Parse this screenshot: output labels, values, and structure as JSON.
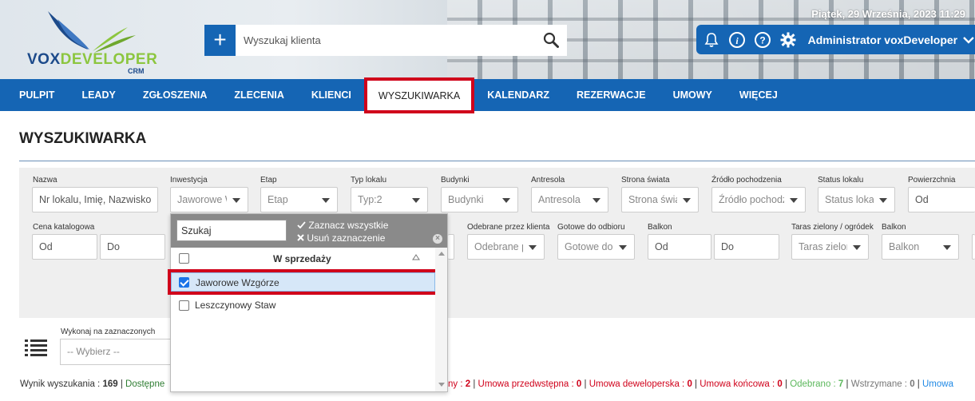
{
  "header": {
    "logo_brand_a": "VOX",
    "logo_brand_b": "DEVELOPER",
    "logo_sub": "CRM",
    "search_placeholder": "Wyszukaj klienta",
    "add_label": "+",
    "date_time": "Piątek, 29 Września, 2023   11:29",
    "username": "Administrator voxDeveloper",
    "icons": [
      "bell-icon",
      "info-icon",
      "help-icon",
      "gear-icon",
      "chevron-down-icon"
    ]
  },
  "nav": {
    "items": [
      "PULPIT",
      "LEADY",
      "ZGŁOSZENIA",
      "ZLECENIA",
      "KLIENCI",
      "WYSZUKIWARKA",
      "KALENDARZ",
      "REZERWACJE",
      "UMOWY",
      "WIĘCEJ"
    ],
    "active": "WYSZUKIWARKA"
  },
  "page": {
    "title": "WYSZUKIWARKA"
  },
  "filters": {
    "row1": [
      {
        "label": "Nazwa",
        "value": "Nr lokalu, Imię, Nazwisko"
      },
      {
        "label": "Inwestycja",
        "value": "Jaworowe W"
      },
      {
        "label": "Etap",
        "value": "Etap"
      },
      {
        "label": "Typ lokalu",
        "value": "Typ:2"
      },
      {
        "label": "Budynki",
        "value": "Budynki"
      },
      {
        "label": "Antresola",
        "value": "Antresola"
      },
      {
        "label": "Strona świata",
        "value": "Strona świa"
      },
      {
        "label": "Źródło pochodzenia",
        "value": "Źródło pochodz"
      },
      {
        "label": "Status lokalu",
        "value": "Status lokal"
      },
      {
        "label": "Powierzchnia",
        "value": "Od"
      }
    ],
    "row2": [
      {
        "label": "Cena katalogowa",
        "value_from": "Od",
        "value_to": "Do"
      },
      {
        "label": "Odebrane przez klienta",
        "value": "Odebrane p"
      },
      {
        "label": "Gotowe do odbioru",
        "value": "Gotowe do"
      },
      {
        "label": "Balkon",
        "value_from": "Od",
        "value_to": "Do"
      },
      {
        "label": "Taras zielony / ogródek",
        "value": "Taras zielon"
      },
      {
        "label": "Balkon",
        "value": "Balkon"
      }
    ]
  },
  "dropdown": {
    "search_placeholder": "Szukaj",
    "select_all": "Zaznacz wszystkie",
    "deselect_all": "Usuń zaznaczenie",
    "group_label": "W sprzedaży",
    "options": [
      {
        "label": "Jaworowe Wzgórze",
        "checked": true
      },
      {
        "label": "Leszczynowy Staw",
        "checked": false
      }
    ]
  },
  "actions": {
    "label": "Wykonaj na zaznaczonych",
    "select_value": "-- Wybierz --"
  },
  "results": {
    "label": "Wynik wyszukania : ",
    "count": "169",
    "sep": " | ",
    "available_partial": "Dostępne",
    "reserved_tail": "ny : ",
    "reserved_count": "2",
    "prelim": "Umowa przedwstępna : ",
    "prelim_count": "0",
    "dev": "Umowa deweloperska : ",
    "dev_count": "0",
    "final": "Umowa końcowa : ",
    "final_count": "0",
    "received": "Odebrano : ",
    "received_count": "7",
    "held": "Wstrzymane : ",
    "held_count": "0",
    "more": "Umowa"
  },
  "colors": {
    "primary": "#1565b4",
    "highlight": "#d0021b",
    "panel": "#efefef"
  }
}
